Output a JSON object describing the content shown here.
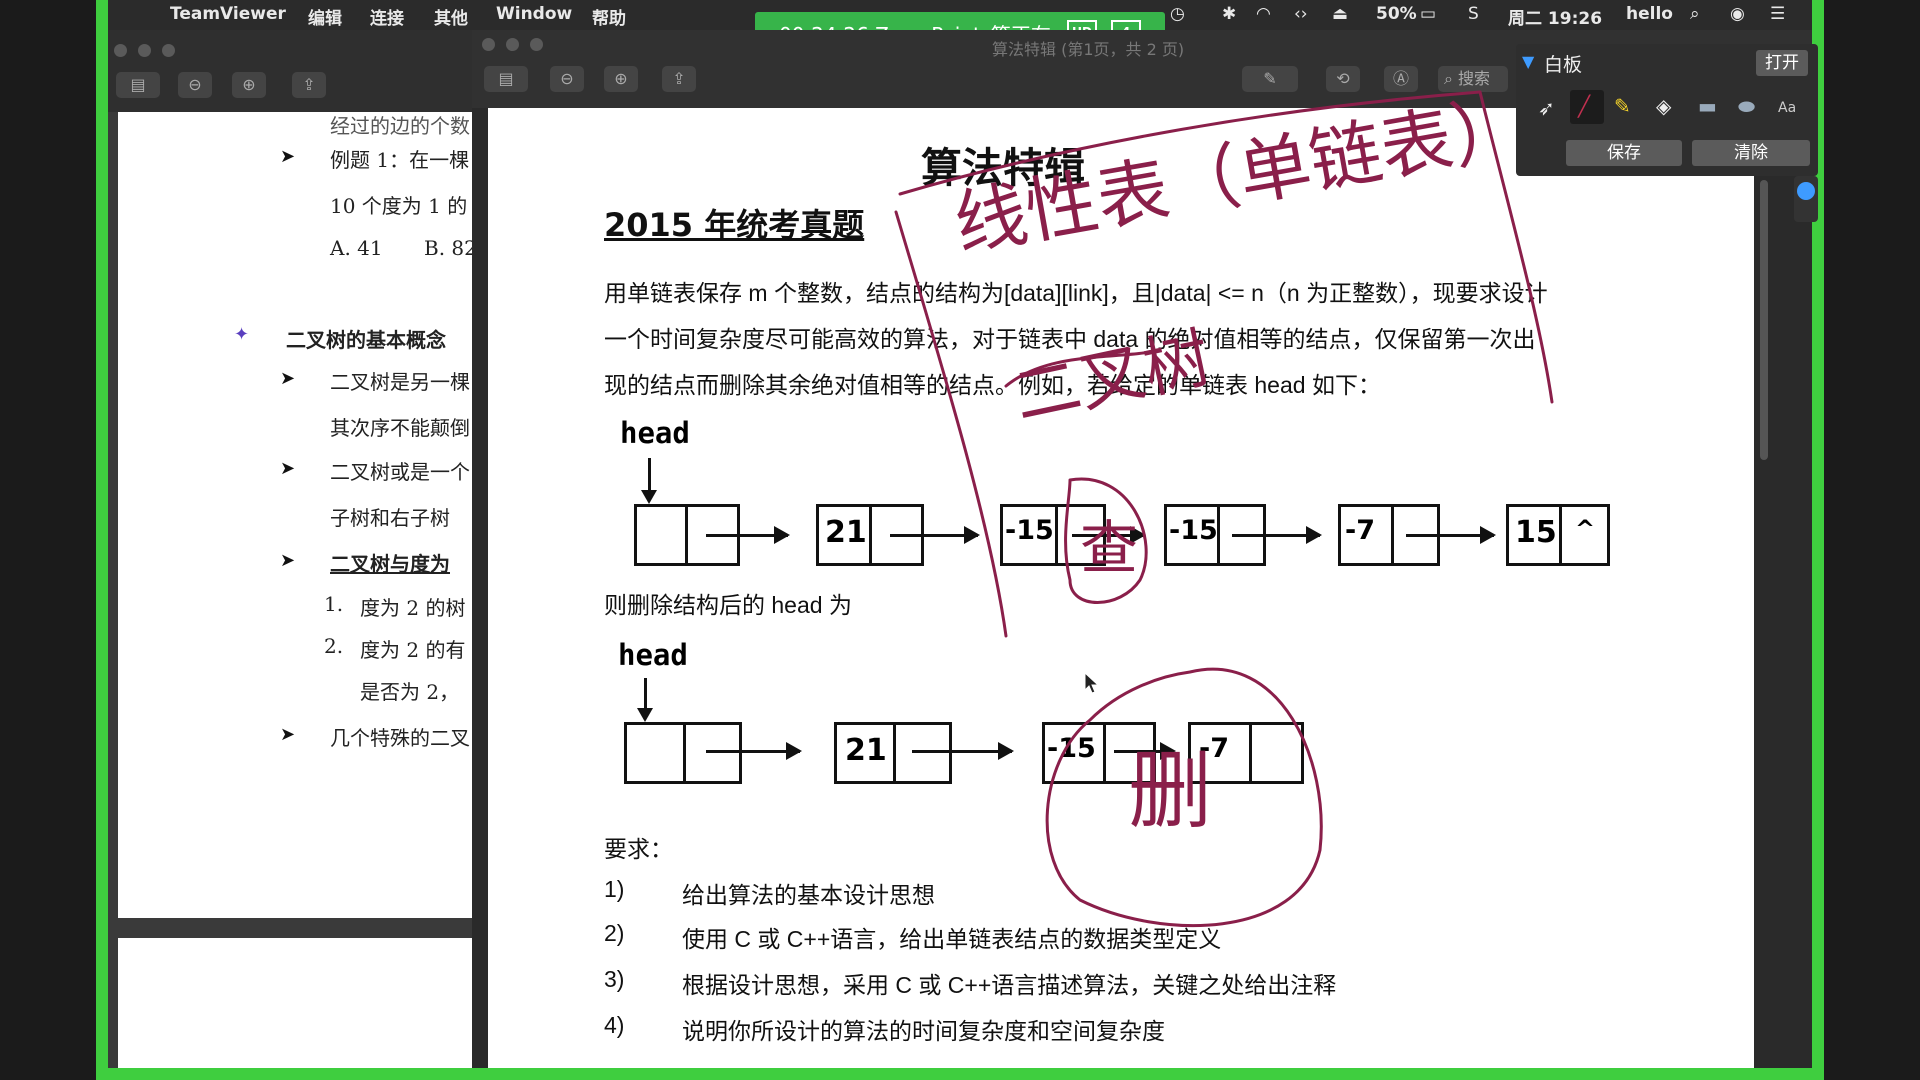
{
  "menubar": {
    "app": "TeamViewer",
    "menus": [
      "编辑",
      "连接",
      "其他",
      "Window",
      "帮助"
    ],
    "battery": "50%",
    "clock": "周二 19:26",
    "user": "hello"
  },
  "session": {
    "text": "00:24:26  Zero_Point_等正在...",
    "hd": "HD",
    "count": "4"
  },
  "preview_title": "算法特辑 (第1页，共 2 页)",
  "search_placeholder": "搜索",
  "left_doc": {
    "lines": [
      "经过的边的个数",
      "例题 1：在一棵",
      "10 个度为 1 的",
      "A. 41",
      "B. 82",
      "二叉树的基本概念",
      "二叉树是另一棵",
      "其次序不能颠倒",
      "二叉树或是一个",
      "子树和右子树",
      "二叉树与度为",
      "1.",
      "度为 2 的树",
      "2.",
      "度为 2 的有",
      "是否为 2，",
      "几个特殊的二叉"
    ]
  },
  "doc": {
    "title": "算法特辑",
    "section": "2015 年统考真题",
    "para": [
      "用单链表保存 m 个整数，结点的结构为[data][link]，且|data| <= n（n 为正整数），现要求设计",
      "一个时间复杂度尽可能高效的算法，对于链表中 data 的绝对值相等的结点，仅保留第一次出",
      "现的结点而删除其余绝对值相等的结点。例如，若给定的单链表 head 如下："
    ],
    "head_label": "head",
    "list1": [
      "",
      "21",
      "-15",
      "-15",
      "-7",
      "15"
    ],
    "null_mark": "^",
    "after_text": "则删除结构后的 head 为",
    "list2": [
      "",
      "21",
      "-15",
      "-7"
    ],
    "req_title": "要求：",
    "requirements": [
      {
        "n": "1)",
        "t": "给出算法的基本设计思想"
      },
      {
        "n": "2)",
        "t": "使用 C 或 C++语言，给出单链表结点的数据类型定义"
      },
      {
        "n": "3)",
        "t": "根据设计思想，采用 C 或 C++语言描述算法，关键之处给出注释"
      },
      {
        "n": "4)",
        "t": "说明你所设计的算法的时间复杂度和空间复杂度"
      }
    ]
  },
  "whiteboard": {
    "title": "白板",
    "open": "打开",
    "save": "保存",
    "clear": "清除",
    "tools": [
      "cursor-icon",
      "pen-icon",
      "highlighter-icon",
      "eraser-icon",
      "rectangle-icon",
      "ellipse-icon",
      "text-icon"
    ],
    "text_tool": "Aa",
    "ink_color": "#8a1f4a"
  },
  "annotations": {
    "top": "线性表（单链表）",
    "middle": "二叉树",
    "circle1": "查",
    "circle2": "删"
  }
}
